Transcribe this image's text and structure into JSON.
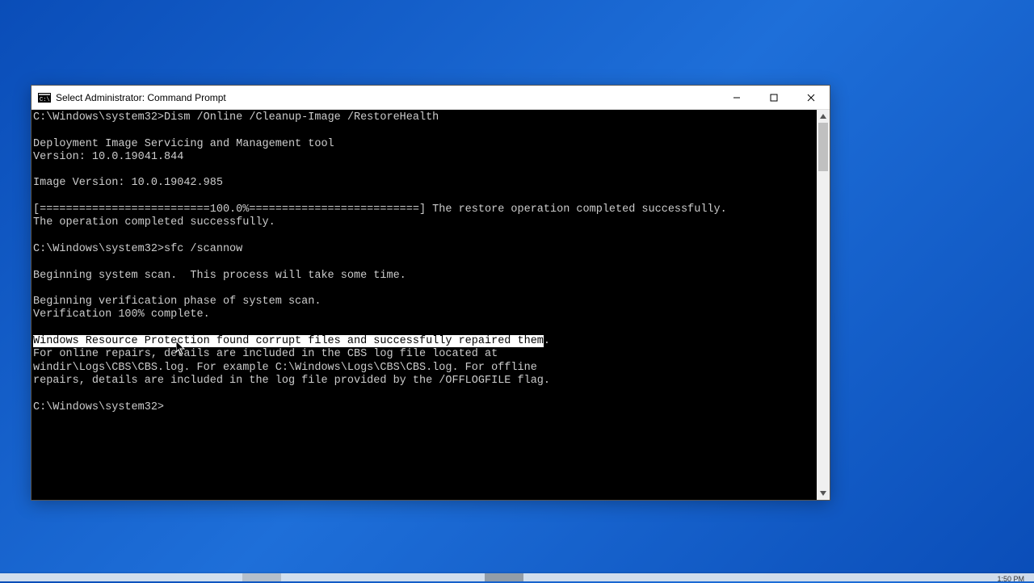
{
  "window": {
    "title": "Select Administrator: Command Prompt",
    "controls": {
      "minimize": "—",
      "maximize": "☐",
      "close": "✕"
    }
  },
  "console": {
    "prompt1_path": "C:\\Windows\\system32>",
    "cmd1": "Dism /Online /Cleanup-Image /RestoreHealth",
    "dism_tool": "Deployment Image Servicing and Management tool",
    "dism_version": "Version: 10.0.19041.844",
    "image_version": "Image Version: 10.0.19042.985",
    "progress_bar": "[==========================100.0%==========================] The restore operation completed successfully.",
    "op_complete": "The operation completed successfully.",
    "prompt2_path": "C:\\Windows\\system32>",
    "cmd2": "sfc /scannow",
    "scan_begin": "Beginning system scan.  This process will take some time.",
    "verif_begin": "Beginning verification phase of system scan.",
    "verif_complete": "Verification 100% complete.",
    "wrp_highlight": "Windows Resource Protection found corrupt files and successfully repaired them",
    "wrp_end": ".",
    "wrp_line2": "For online repairs, details are included in the CBS log file located at",
    "wrp_line3": "windir\\Logs\\CBS\\CBS.log. For example C:\\Windows\\Logs\\CBS\\CBS.log. For offline",
    "wrp_line4": "repairs, details are included in the log file provided by the /OFFLOGFILE flag.",
    "prompt3_path": "C:\\Windows\\system32>"
  },
  "taskbar": {
    "clock": "1:50 PM"
  }
}
